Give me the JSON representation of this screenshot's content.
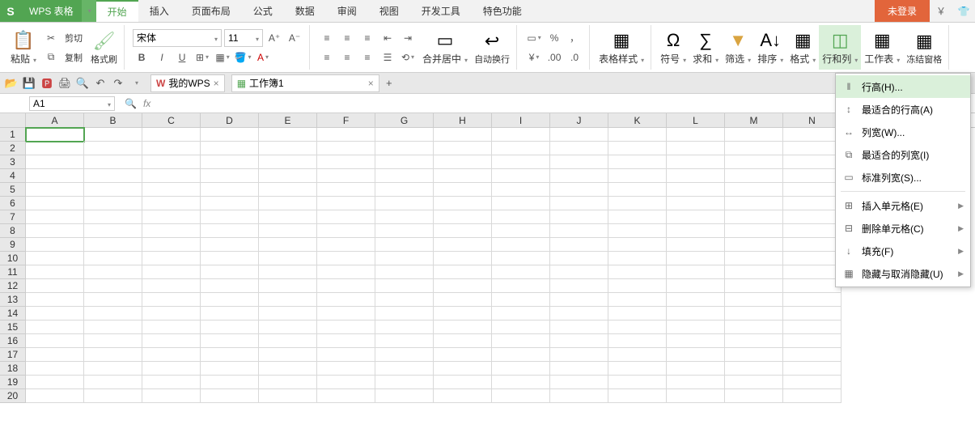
{
  "titlebar": {
    "app_name": "WPS 表格",
    "tabs": [
      "开始",
      "插入",
      "页面布局",
      "公式",
      "数据",
      "审阅",
      "视图",
      "开发工具",
      "特色功能"
    ],
    "active_tab_index": 0,
    "not_logged": "未登录"
  },
  "ribbon": {
    "paste": "粘贴",
    "cut": "剪切",
    "copy": "复制",
    "fmt_painter": "格式刷",
    "font_name": "宋体",
    "font_size": "11",
    "merge_center": "合并居中",
    "wrap_text": "自动换行",
    "table_style": "表格样式",
    "symbols": "符号",
    "sum": "求和",
    "filter": "筛选",
    "sort": "排序",
    "format": "格式",
    "row_col": "行和列",
    "worksheet": "工作表",
    "freeze": "冻结窗格"
  },
  "doc_tabs": {
    "my_wps": "我的WPS",
    "workbook": "工作簿1"
  },
  "formula": {
    "cell_ref": "A1",
    "fx": "fx"
  },
  "columns": [
    "A",
    "B",
    "C",
    "D",
    "E",
    "F",
    "G",
    "H",
    "I",
    "J",
    "K",
    "L",
    "M",
    "N"
  ],
  "row_count": 20,
  "menu": {
    "items": [
      {
        "label": "行高(H)...",
        "icon": "‖",
        "hover": true
      },
      {
        "label": "最适合的行高(A)",
        "icon": "↕"
      },
      {
        "label": "列宽(W)...",
        "icon": "↔"
      },
      {
        "label": "最适合的列宽(I)",
        "icon": "⧉"
      },
      {
        "label": "标准列宽(S)...",
        "icon": "▭"
      },
      {
        "sep": true
      },
      {
        "label": "插入单元格(E)",
        "icon": "⊞",
        "arrow": true
      },
      {
        "label": "删除单元格(C)",
        "icon": "⊟",
        "arrow": true
      },
      {
        "label": "填充(F)",
        "icon": "↓",
        "arrow": true
      },
      {
        "label": "隐藏与取消隐藏(U)",
        "icon": "▦",
        "arrow": true
      }
    ]
  }
}
